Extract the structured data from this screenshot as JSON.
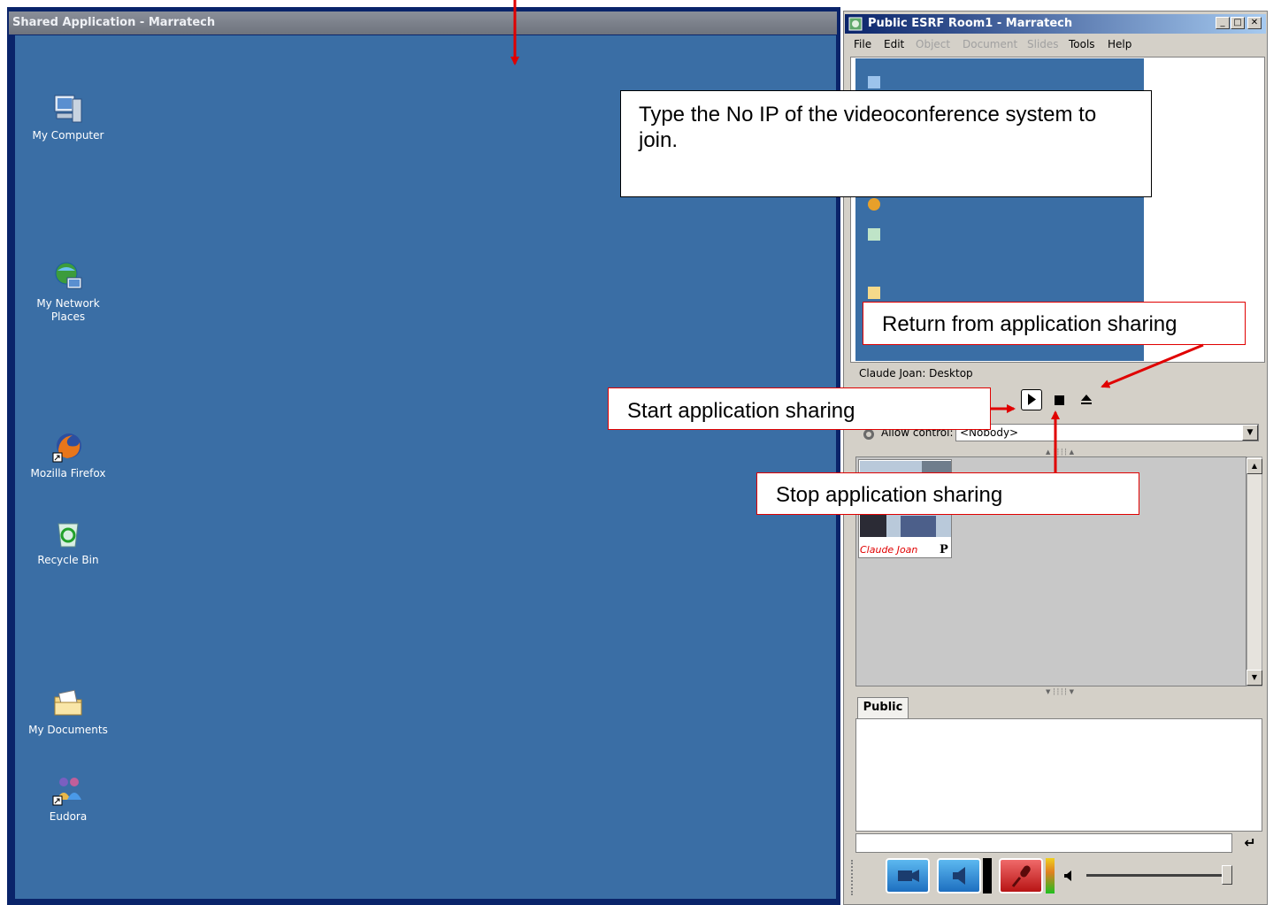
{
  "left_window": {
    "title": "Shared Application - Marratech",
    "desktop_icons": [
      {
        "label": "My Computer",
        "icon": "my-computer-icon"
      },
      {
        "label": "My Network Places",
        "icon": "network-places-icon"
      },
      {
        "label": "Mozilla Firefox",
        "icon": "firefox-icon"
      },
      {
        "label": "Recycle Bin",
        "icon": "recycle-bin-icon"
      },
      {
        "label": "My Documents",
        "icon": "my-documents-icon"
      },
      {
        "label": "Eudora",
        "icon": "eudora-icon"
      }
    ]
  },
  "right_window": {
    "title": "Public ESRF Room1 - Marratech",
    "menu": [
      {
        "label": "File",
        "enabled": true
      },
      {
        "label": "Edit",
        "enabled": true
      },
      {
        "label": "Object",
        "enabled": false
      },
      {
        "label": "Document",
        "enabled": false
      },
      {
        "label": "Slides",
        "enabled": false
      },
      {
        "label": "Tools",
        "enabled": true
      },
      {
        "label": "Help",
        "enabled": true
      }
    ],
    "share_status": "Claude Joan: Desktop",
    "allow_control_label": "Allow control:",
    "allow_control_value": "<Nobody>",
    "participant": {
      "name": "Claude Joan",
      "badge": "P"
    },
    "chat_tab": "Public",
    "colors": {
      "desktop": "#3a6ea5",
      "title_gradient_start": "#0a246a",
      "callout_red": "#e00000"
    }
  },
  "callouts": {
    "ip_note": "Type the No IP of the videoconference system to join.",
    "return": "Return from application sharing",
    "start": "Start application sharing",
    "stop": "Stop application sharing"
  }
}
